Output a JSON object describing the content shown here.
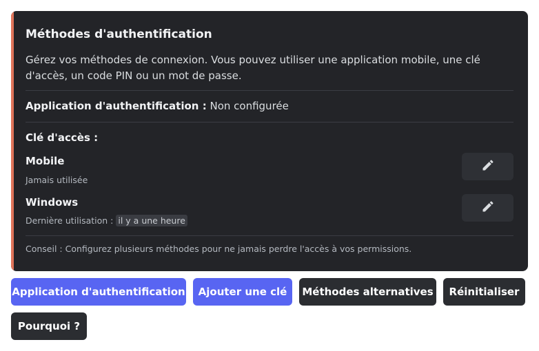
{
  "card": {
    "accent_color": "#e0745a",
    "title": "Méthodes d'authentification",
    "description": "Gérez vos méthodes de connexion. Vous pouvez utiliser une application mobile, une clé d'accès, un code PIN ou un mot de passe.",
    "authenticator_label": "Application d'authentification :",
    "authenticator_status": "Non configurée",
    "keys_label": "Clé d'accès :",
    "keys": [
      {
        "name": "Mobile",
        "last_used_prefix": "Jamais utilisée",
        "last_used_value": "",
        "action_icon": "pencil-icon"
      },
      {
        "name": "Windows",
        "last_used_prefix": "Dernière utilisation :",
        "last_used_value": "il y a une heure",
        "action_icon": "pencil-icon"
      }
    ],
    "tip": "Conseil : Configurez plusieurs méthodes pour ne jamais perdre l'accès à vos permissions."
  },
  "actions": {
    "authenticator_app": "Application d'authentification",
    "add_key": "Ajouter une clé",
    "alternative_methods": "Méthodes alternatives",
    "reset": "Réinitialiser",
    "why": "Pourquoi ?"
  },
  "colors": {
    "primary": "#5865f2",
    "dark_button": "#2b2d31",
    "card_bg": "#232428"
  }
}
